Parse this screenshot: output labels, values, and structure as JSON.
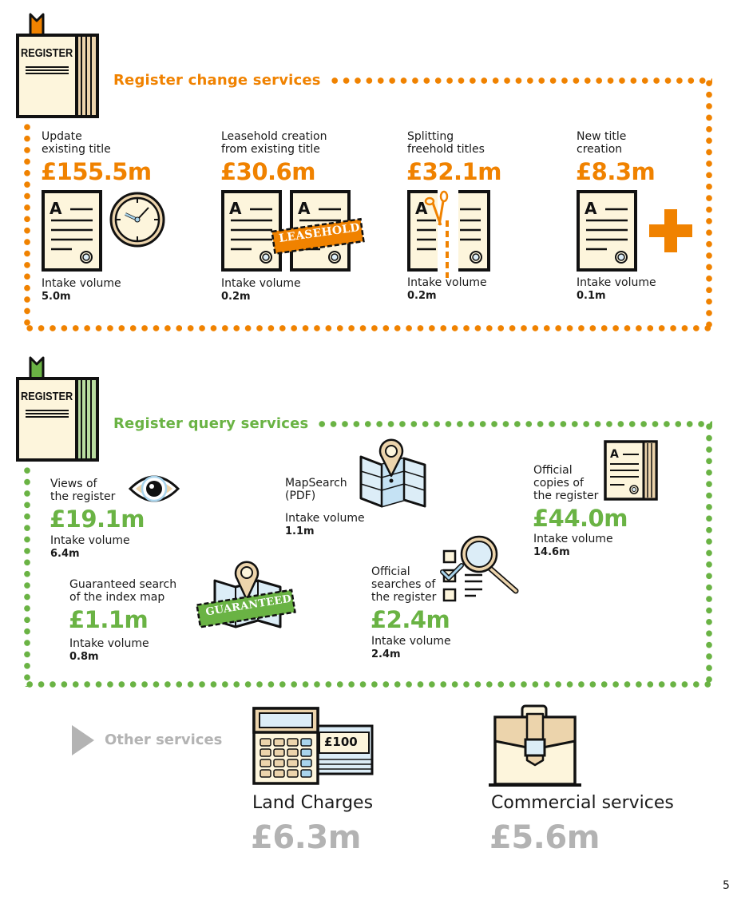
{
  "colors": {
    "change_accent": "#f08200",
    "query_accent": "#6ab344",
    "other_accent": "#b3b3b3",
    "paper": "#fdf5dc",
    "tan": "#ecd4ac",
    "light_blue": "#dcedf7",
    "ink": "#111111"
  },
  "register_book_label": "REGISTER",
  "change_services": {
    "title": "Register change services",
    "items": [
      {
        "label_line1": "Update",
        "label_line2": "existing title",
        "amount": "£155.5m",
        "intake_label": "Intake volume",
        "intake_value": "5.0m",
        "icon": "document-with-clock"
      },
      {
        "label_line1": "Leasehold creation",
        "label_line2": "from existing title",
        "amount": "£30.6m",
        "intake_label": "Intake volume",
        "intake_value": "0.2m",
        "icon": "two-documents-leasehold-stamp",
        "stamp_text": "LEASEHOLD"
      },
      {
        "label_line1": "Splitting",
        "label_line2": "freehold titles",
        "amount": "£32.1m",
        "intake_label": "Intake volume",
        "intake_value": "0.2m",
        "icon": "document-with-scissors"
      },
      {
        "label_line1": "New title",
        "label_line2": "creation",
        "amount": "£8.3m",
        "intake_label": "Intake volume",
        "intake_value": "0.1m",
        "icon": "document-with-plus"
      }
    ]
  },
  "query_services": {
    "title": "Register query services",
    "items": [
      {
        "label_line1": "Views of",
        "label_line2": "the register",
        "amount": "£19.1m",
        "intake_label": "Intake volume",
        "intake_value": "6.4m",
        "icon": "eye"
      },
      {
        "label_line1": "MapSearch",
        "label_line2": "(PDF)",
        "amount": "",
        "intake_label": "Intake volume",
        "intake_value": "1.1m",
        "icon": "map-with-pin"
      },
      {
        "label_line1": "Official",
        "label_line2": "copies of",
        "label_line3": "the register",
        "amount": "£44.0m",
        "intake_label": "Intake volume",
        "intake_value": "14.6m",
        "icon": "register-document"
      },
      {
        "label_line1": "Guaranteed search",
        "label_line2": "of the index map",
        "amount": "£1.1m",
        "intake_label": "Intake volume",
        "intake_value": "0.8m",
        "icon": "map-guaranteed-stamp",
        "stamp_text": "GUARANTEED"
      },
      {
        "label_line1": "Official",
        "label_line2": "searches of",
        "label_line3": "the register",
        "amount": "£2.4m",
        "intake_label": "Intake volume",
        "intake_value": "2.4m",
        "icon": "checklist-magnifier"
      }
    ]
  },
  "other_services": {
    "title": "Other services",
    "items": [
      {
        "label": "Land Charges",
        "amount": "£6.3m",
        "icon": "calculator-banknotes",
        "note_text": "£100"
      },
      {
        "label": "Commercial services",
        "amount": "£5.6m",
        "icon": "briefcase"
      }
    ]
  },
  "page_number": "5"
}
